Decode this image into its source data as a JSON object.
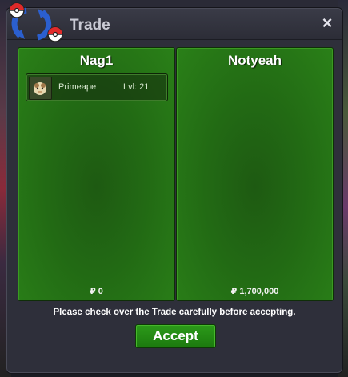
{
  "window": {
    "title": "Trade",
    "close_icon": "×"
  },
  "left_panel": {
    "player_name": "Nag1",
    "items": [
      {
        "pokemon": "Primeape",
        "level": "Lvl: 21"
      }
    ],
    "money": "₽ 0"
  },
  "right_panel": {
    "player_name": "Notyeah",
    "items": [],
    "money": "₽ 1,700,000"
  },
  "notice": "Please check over the Trade carefully before accepting.",
  "accept_label": "Accept",
  "colors": {
    "panel_green": "#226a14",
    "accept_green": "#2c9a1a",
    "window_bg": "#2e2f3a"
  }
}
